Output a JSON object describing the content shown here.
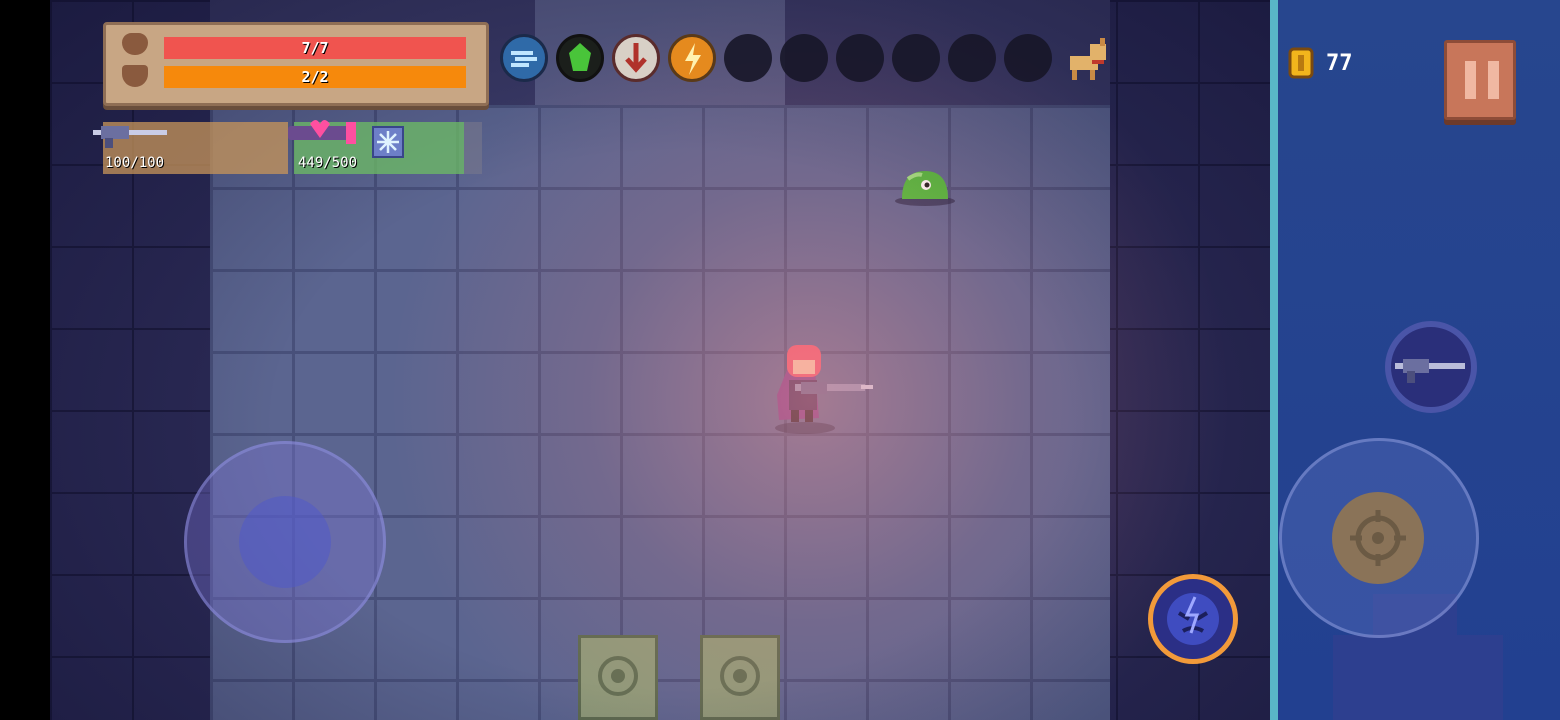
{
  "hud": {
    "health": {
      "current": 7,
      "max": 7,
      "text": "7/7"
    },
    "armor": {
      "current": 2,
      "max": 2,
      "text": "2/2"
    },
    "weapons": [
      {
        "name": "sniper-rifle",
        "ammo_text": "100/100"
      },
      {
        "name": "heart-blaster",
        "ammo_text": "449/500"
      }
    ],
    "buffs": [
      "wind-buff-icon",
      "gem-buff-icon",
      "down-arrow-buff-icon",
      "lightning-buff-icon"
    ],
    "empty_buff_slots": 6,
    "pet": "dog-pet"
  },
  "coins": {
    "count": "77"
  },
  "controls": {
    "pause": "pause-button",
    "weapon_switch": "weapon-swap-button",
    "skill": "skill-button",
    "fire": "attack-joystick",
    "move": "move-joystick"
  },
  "colors": {
    "health_bar": "#f0544f",
    "armor_bar": "#f6890c",
    "panel": "#c8a684",
    "skill_ring": "#f29a3a",
    "slime": "#4cbb3a"
  }
}
